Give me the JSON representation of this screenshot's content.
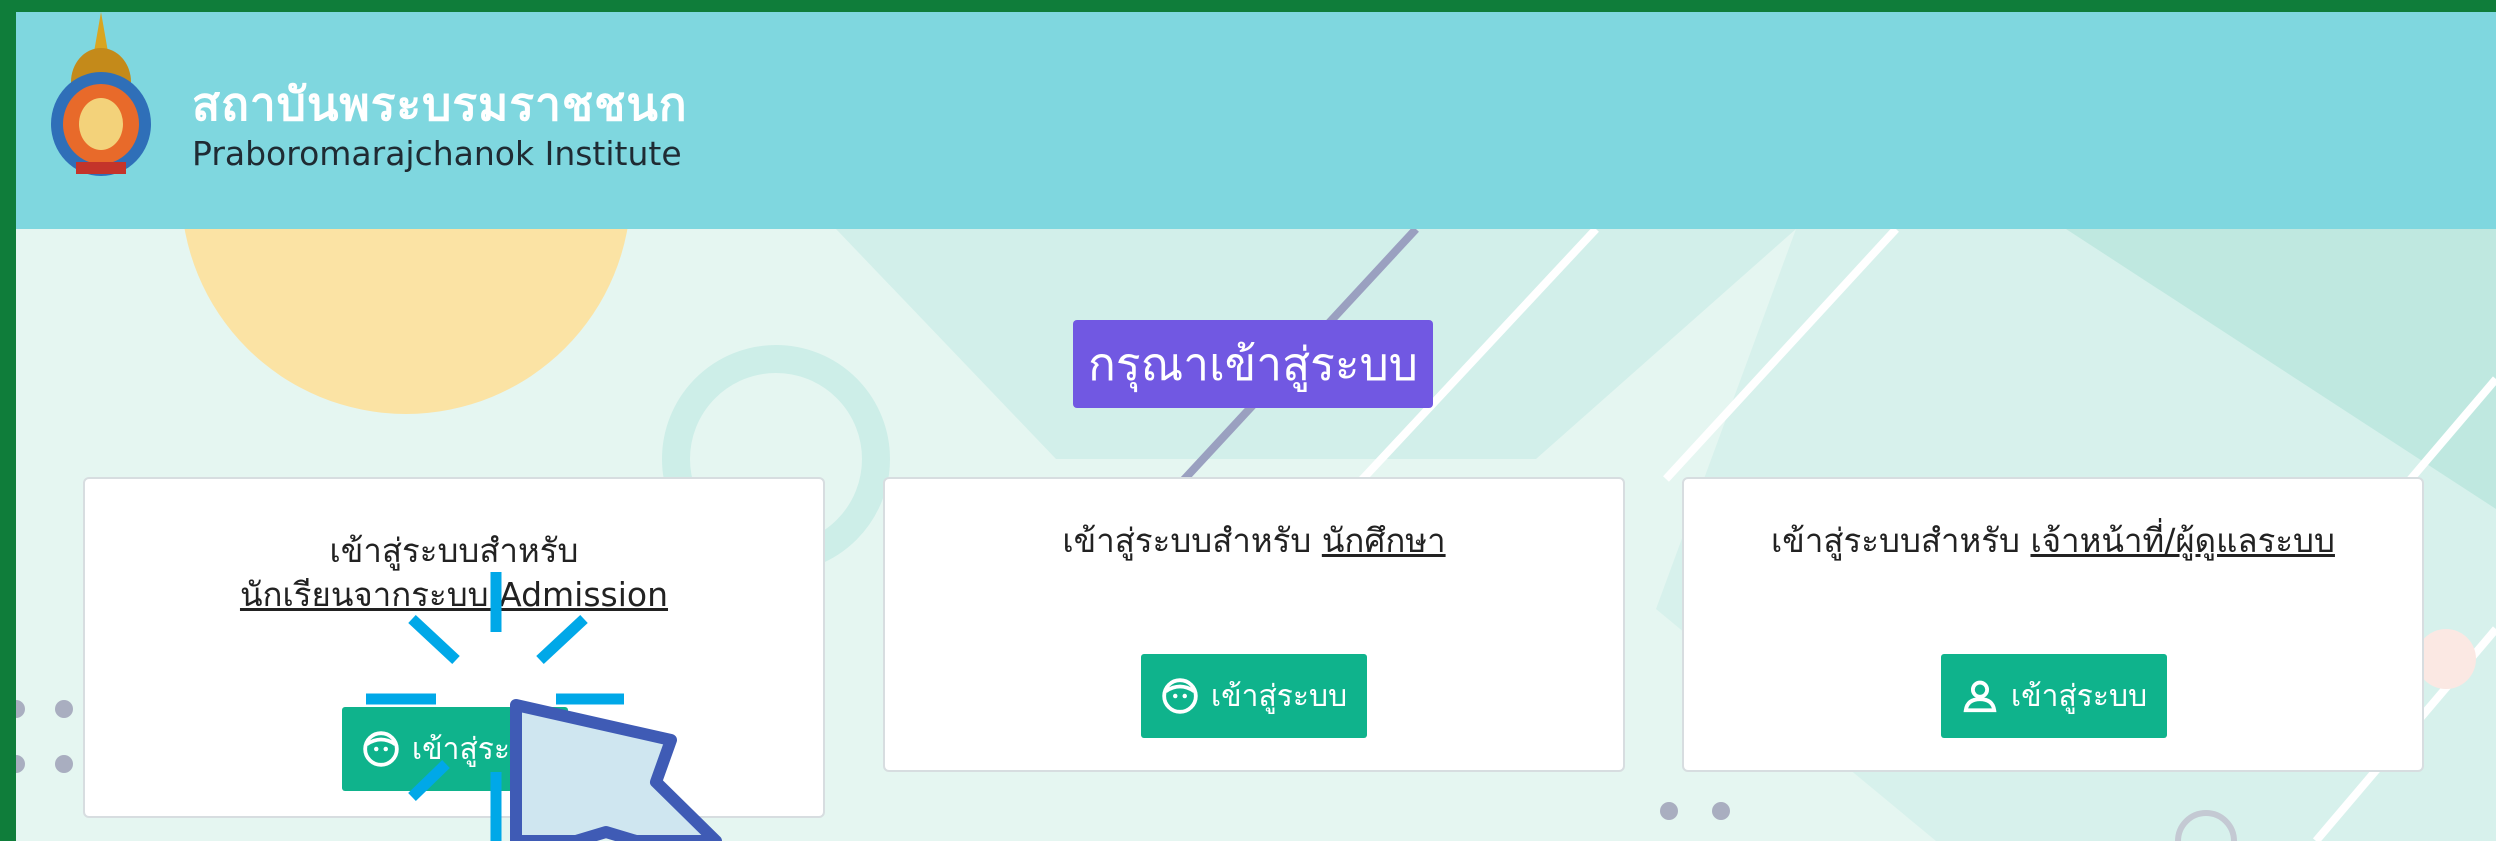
{
  "header": {
    "institute_name_th": "สถาบันพระบรมราชชนก",
    "institute_name_en": "Praboromarajchanok Institute",
    "logo_icon": "institute-emblem-icon"
  },
  "page_title": "กรุณาเข้าสู่ระบบ",
  "cards": [
    {
      "prefix": "เข้าสู่ระบบสำหรับ",
      "target": "นักเรียนจากระบบ Admission",
      "button_label": "เข้าสู่ระบบ",
      "button_icon": "face-icon"
    },
    {
      "prefix": "เข้าสู่ระบบสำหรับ",
      "target": "นักศึกษา",
      "button_label": "เข้าสู่ระบบ",
      "button_icon": "face-icon"
    },
    {
      "prefix": "เข้าสู่ระบบสำหรับ",
      "target": "เจ้าหน้าที่/ผู้ดูแลระบบ",
      "button_label": "เข้าสู่ระบบ",
      "button_icon": "user-icon"
    }
  ],
  "colors": {
    "border_frame": "#0f7d3a",
    "header_bg": "#7fd7df",
    "title_bg": "#7158e2",
    "button_bg": "#0fb38c",
    "click_cursor": "#3f5bb5",
    "click_burst": "#00a8e8"
  }
}
